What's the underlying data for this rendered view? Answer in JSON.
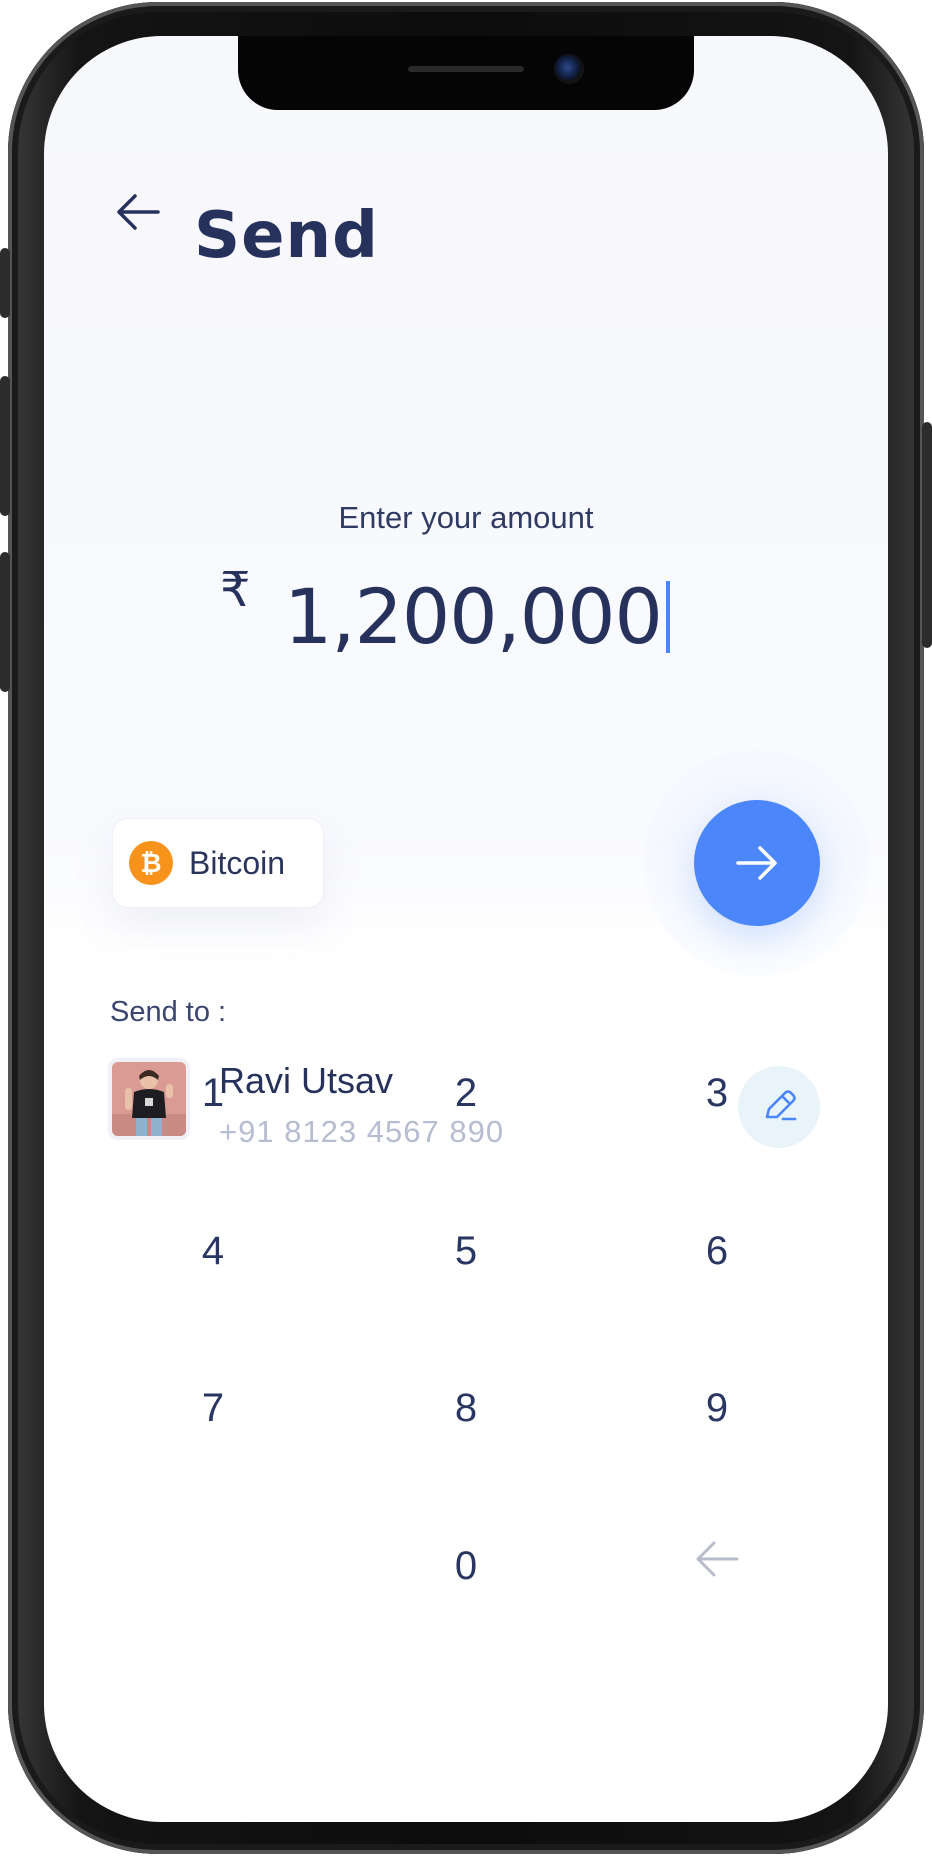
{
  "header": {
    "title": "Send"
  },
  "amount": {
    "label": "Enter your amount",
    "currency_symbol": "₹",
    "value": "1,200,000"
  },
  "coin": {
    "label": "Bitcoin",
    "icon": "bitcoin-icon",
    "color": "#f7931a"
  },
  "recipient": {
    "label": "Send to :",
    "name": "Ravi Utsav",
    "phone": "+91 8123 4567 890"
  },
  "keypad": {
    "k1": "1",
    "k2": "2",
    "k3": "3",
    "k4": "4",
    "k5": "5",
    "k6": "6",
    "k7": "7",
    "k8": "8",
    "k9": "9",
    "k0": "0"
  },
  "colors": {
    "accent": "#4c86fb",
    "text": "#26325c",
    "muted": "#b6bdd1"
  }
}
